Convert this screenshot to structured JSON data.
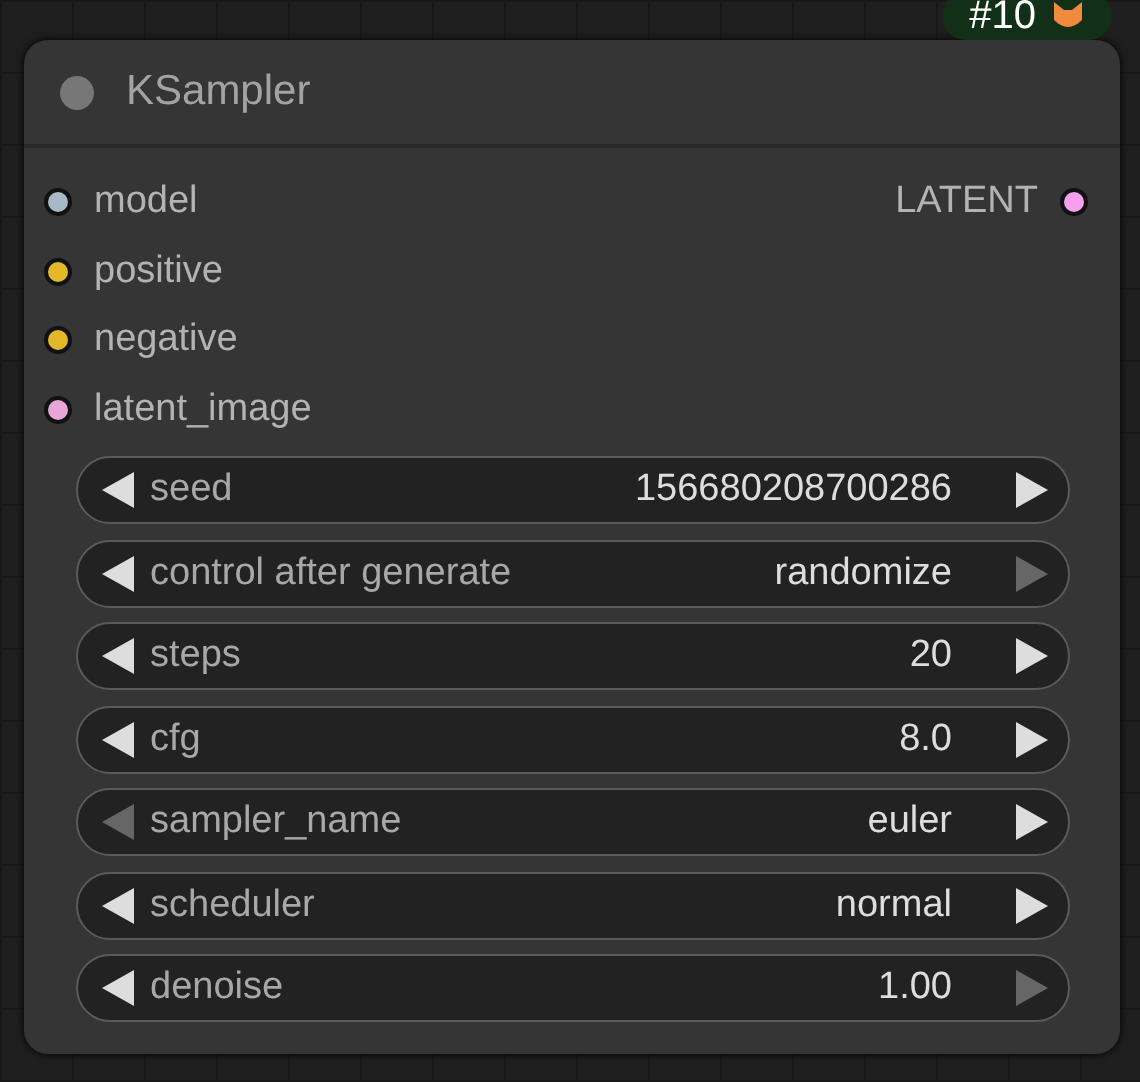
{
  "badge": {
    "text": "#10"
  },
  "node": {
    "title": "KSampler",
    "inputs": [
      {
        "name": "model",
        "color": "#a9b8c6"
      },
      {
        "name": "positive",
        "color": "#e2b72a"
      },
      {
        "name": "negative",
        "color": "#e2b72a"
      },
      {
        "name": "latent_image",
        "color": "#e7a6d6"
      }
    ],
    "outputs": [
      {
        "name": "LATENT",
        "color": "#f5a0ee"
      }
    ],
    "widgets": [
      {
        "label": "seed",
        "value": "156680208700286",
        "left_enabled": true,
        "right_enabled": true
      },
      {
        "label": "control after generate",
        "value": "randomize",
        "left_enabled": true,
        "right_enabled": false
      },
      {
        "label": "steps",
        "value": "20",
        "left_enabled": true,
        "right_enabled": true
      },
      {
        "label": "cfg",
        "value": "8.0",
        "left_enabled": true,
        "right_enabled": true
      },
      {
        "label": "sampler_name",
        "value": "euler",
        "left_enabled": false,
        "right_enabled": true
      },
      {
        "label": "scheduler",
        "value": "normal",
        "left_enabled": true,
        "right_enabled": true
      },
      {
        "label": "denoise",
        "value": "1.00",
        "left_enabled": true,
        "right_enabled": false
      }
    ]
  }
}
